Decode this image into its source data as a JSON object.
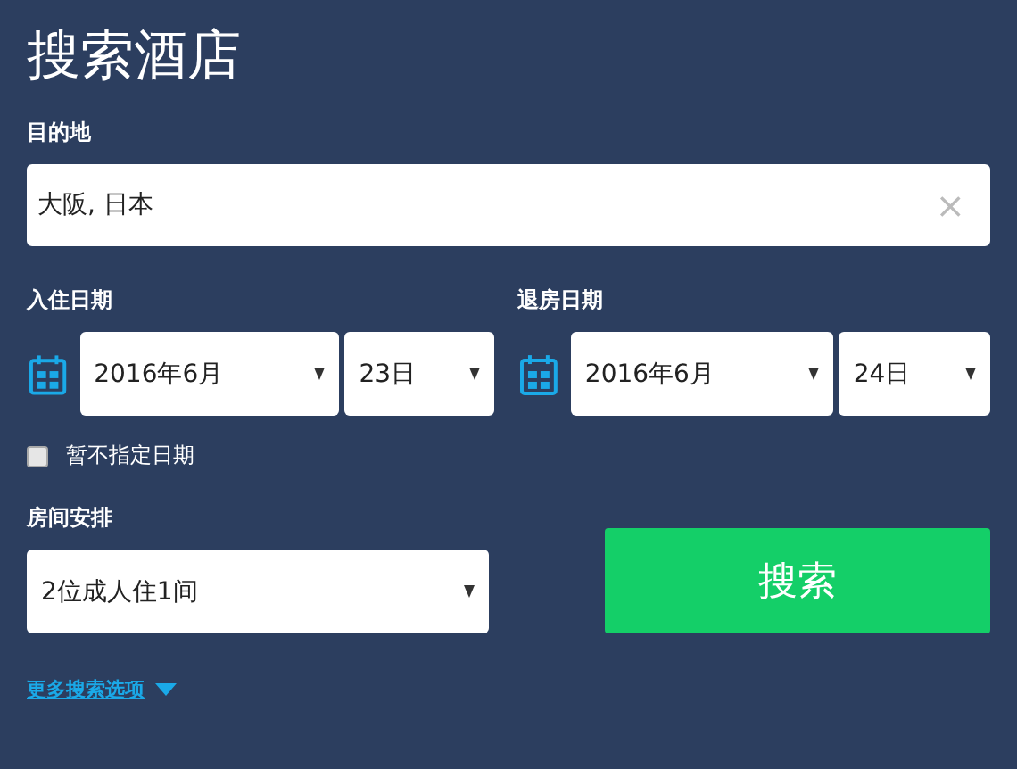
{
  "title": "搜索酒店",
  "destination": {
    "label": "目的地",
    "value": "大阪, 日本",
    "clear": "×"
  },
  "dates": [
    {
      "label": "入住日期",
      "month": "2016年6月",
      "day": "23日"
    },
    {
      "label": "退房日期",
      "month": "2016年6月",
      "day": "24日"
    }
  ],
  "no_dates": {
    "label": "暂不指定日期",
    "checked": false
  },
  "rooms": {
    "label": "房间安排",
    "value": "2位成人住1间"
  },
  "search_button": "搜索",
  "more_options": "更多搜索选项"
}
